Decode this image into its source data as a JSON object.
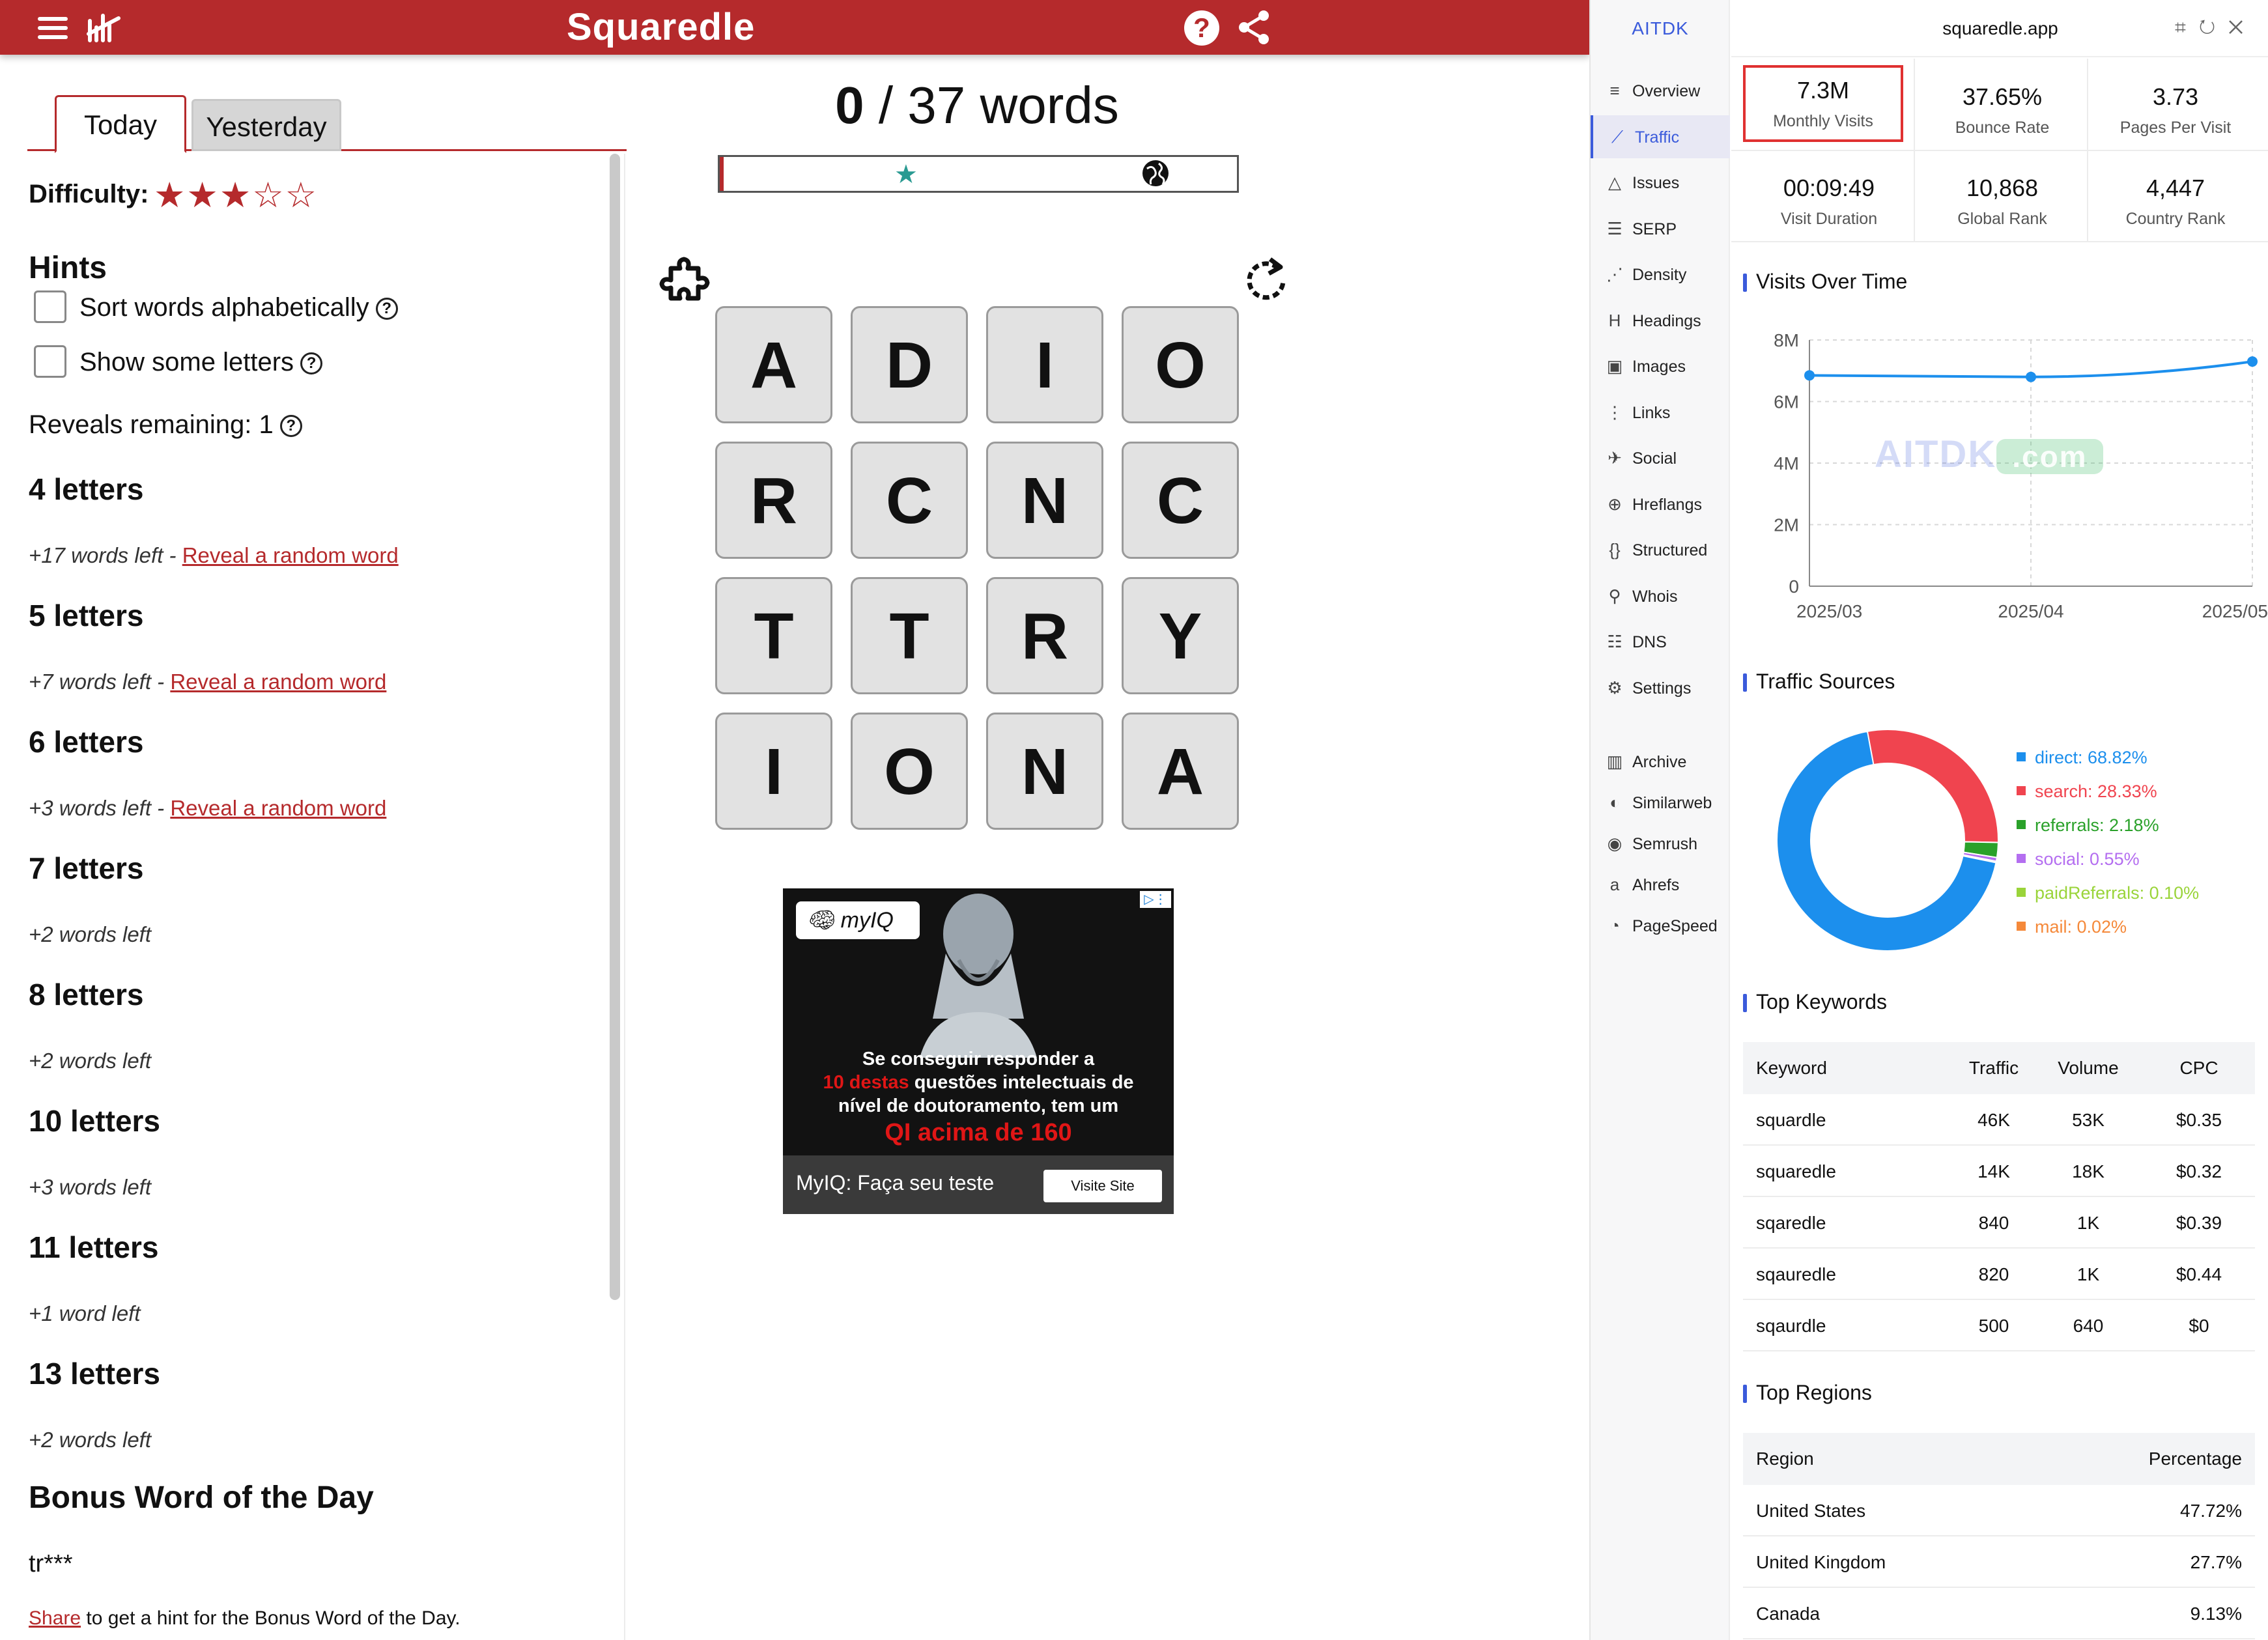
{
  "game": {
    "logo": "Squaredle",
    "tabs": {
      "today": "Today",
      "yesterday": "Yesterday"
    },
    "difficulty_label": "Difficulty:",
    "difficulty_stars": "★★★☆☆",
    "hints_title": "Hints",
    "hint_sort": "Sort words alphabetically",
    "hint_show": "Show some letters",
    "reveals": "Reveals remaining: 1",
    "reveal_link": "Reveal a random word",
    "sections": [
      {
        "title": "4 letters",
        "left": "+17 words left",
        "reveal": true
      },
      {
        "title": "5 letters",
        "left": "+7 words left",
        "reveal": true
      },
      {
        "title": "6 letters",
        "left": "+3 words left",
        "reveal": true
      },
      {
        "title": "7 letters",
        "left": "+2 words left",
        "reveal": false
      },
      {
        "title": "8 letters",
        "left": "+2 words left",
        "reveal": false
      },
      {
        "title": "10 letters",
        "left": "+3 words left",
        "reveal": false
      },
      {
        "title": "11 letters",
        "left": "+1 word left",
        "reveal": false
      },
      {
        "title": "13 letters",
        "left": "+2 words left",
        "reveal": false
      }
    ],
    "separator": " - ",
    "bonus_title": "Bonus Word of the Day",
    "bonus_word": "tr***",
    "bonus_share_link": "Share",
    "bonus_share_text": " to get a hint for the Bonus Word of the Day.",
    "found": "0",
    "slash": " / ",
    "total": "37 words",
    "progress_fraction": 0.0,
    "board": [
      "A",
      "D",
      "I",
      "O",
      "R",
      "C",
      "N",
      "C",
      "T",
      "T",
      "R",
      "Y",
      "I",
      "O",
      "N",
      "A"
    ],
    "ad": {
      "logo": "myIQ",
      "line1": "Se conseguir responder a",
      "line2_red": "10 destas",
      "line2_rest": " questões intelectuais de",
      "line3": "nível de doutoramento, tem um",
      "line4_red": "QI acima de 160",
      "cta": "MyIQ: Faça seu teste",
      "visit": "Visite Site"
    }
  },
  "ext": {
    "brand": "AITDK",
    "domain": "squaredle.app",
    "nav": [
      {
        "label": "Overview",
        "icon": "≡",
        "active": false
      },
      {
        "label": "Traffic",
        "icon": "⟋",
        "active": true
      },
      {
        "label": "Issues",
        "icon": "△",
        "active": false
      },
      {
        "label": "SERP",
        "icon": "☰",
        "active": false
      },
      {
        "label": "Density",
        "icon": "⋰",
        "active": false
      },
      {
        "label": "Headings",
        "icon": "H",
        "active": false
      },
      {
        "label": "Images",
        "icon": "▣",
        "active": false
      },
      {
        "label": "Links",
        "icon": "⋮",
        "active": false
      },
      {
        "label": "Social",
        "icon": "✈",
        "active": false
      },
      {
        "label": "Hreflangs",
        "icon": "⊕",
        "active": false
      },
      {
        "label": "Structured",
        "icon": "{}",
        "active": false
      },
      {
        "label": "Whois",
        "icon": "⚲",
        "active": false
      },
      {
        "label": "DNS",
        "icon": "☷",
        "active": false
      },
      {
        "label": "Settings",
        "icon": "⚙",
        "active": false
      }
    ],
    "nav_tools": [
      {
        "label": "Archive",
        "icon": "▥"
      },
      {
        "label": "Similarweb",
        "icon": "◐"
      },
      {
        "label": "Semrush",
        "icon": "◉"
      },
      {
        "label": "Ahrefs",
        "icon": "a"
      },
      {
        "label": "PageSpeed",
        "icon": "◔"
      }
    ],
    "metrics": [
      {
        "value": "7.3M",
        "label": "Monthly Visits",
        "highlight": true
      },
      {
        "value": "37.65%",
        "label": "Bounce Rate",
        "highlight": false
      },
      {
        "value": "3.73",
        "label": "Pages Per Visit",
        "highlight": false
      },
      {
        "value": "00:09:49",
        "label": "Visit Duration",
        "highlight": false
      },
      {
        "value": "10,868",
        "label": "Global Rank",
        "highlight": false
      },
      {
        "value": "4,447",
        "label": "Country Rank",
        "highlight": false
      }
    ],
    "visits_title": "Visits Over Time",
    "watermark": "AITDK",
    "watermark_suffix": ".com",
    "sources_title": "Traffic Sources",
    "sources": [
      {
        "label": "direct: 68.82%",
        "value": 68.82,
        "color": "#1c8fed"
      },
      {
        "label": "search: 28.33%",
        "value": 28.33,
        "color": "#f0444f"
      },
      {
        "label": "referrals: 2.18%",
        "value": 2.18,
        "color": "#2aa12a"
      },
      {
        "label": "social: 0.55%",
        "value": 0.55,
        "color": "#b46ef0"
      },
      {
        "label": "paidReferrals: 0.10%",
        "value": 0.1,
        "color": "#9ad43a"
      },
      {
        "label": "mail: 0.02%",
        "value": 0.02,
        "color": "#f5893a"
      }
    ],
    "keywords_title": "Top Keywords",
    "keywords_headers": [
      "Keyword",
      "Traffic",
      "Volume",
      "CPC"
    ],
    "keywords": [
      [
        "squardle",
        "46K",
        "53K",
        "$0.35"
      ],
      [
        "squaredle",
        "14K",
        "18K",
        "$0.32"
      ],
      [
        "sqaredle",
        "840",
        "1K",
        "$0.39"
      ],
      [
        "sqauredle",
        "820",
        "1K",
        "$0.44"
      ],
      [
        "sqaurdle",
        "500",
        "640",
        "$0"
      ]
    ],
    "regions_title": "Top Regions",
    "regions_headers": [
      "Region",
      "Percentage"
    ],
    "regions": [
      [
        "United States",
        "47.72%"
      ],
      [
        "United Kingdom",
        "27.7%"
      ],
      [
        "Canada",
        "9.13%"
      ]
    ]
  },
  "chart_data": {
    "type": "line",
    "title": "Visits Over Time",
    "categories": [
      "2025/03",
      "2025/04",
      "2025/05"
    ],
    "values": [
      6850000,
      6800000,
      7300000
    ],
    "ylim": [
      0,
      8000000
    ],
    "yticks": [
      "0",
      "2M",
      "4M",
      "6M",
      "8M"
    ],
    "yticks_values": [
      0,
      2000000,
      4000000,
      6000000,
      8000000
    ],
    "grid": true,
    "color": "#1c8fed"
  }
}
